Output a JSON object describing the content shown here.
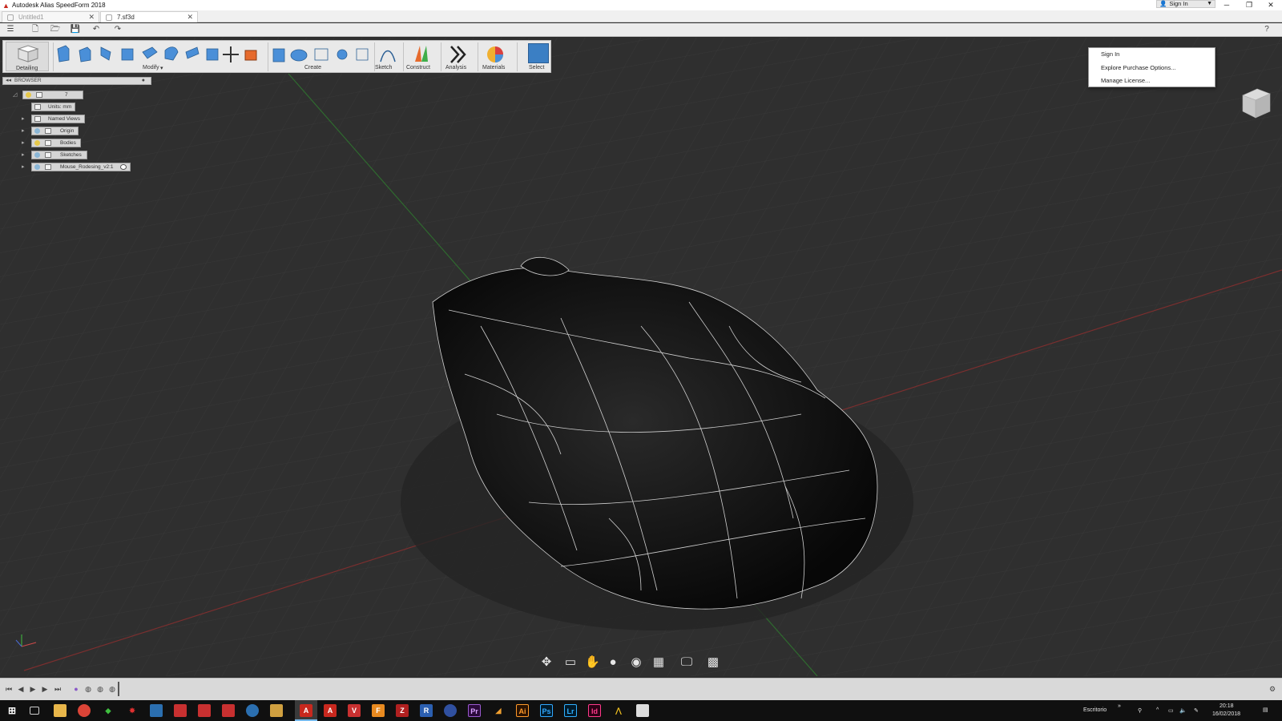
{
  "window": {
    "title": "Autodesk Alias SpeedForm 2018",
    "sign_in_label": "Sign In",
    "minimize": "─",
    "restore": "❐",
    "close": "✕"
  },
  "tabs": [
    {
      "label": "Untitled1",
      "close": "✕"
    },
    {
      "label": "7.sf3d",
      "close": "✕"
    }
  ],
  "signin_menu": [
    "Sign In",
    "Explore Purchase Options...",
    "Manage License..."
  ],
  "ribbon": {
    "workspace": "Detailing",
    "groups": [
      "Modify",
      "Create",
      "Sketch",
      "Construct",
      "Analysis",
      "Materials",
      "Select"
    ]
  },
  "browser": {
    "title": "BROWSER",
    "root_label": "7",
    "items": [
      {
        "label": "Units: mm"
      },
      {
        "label": "Named Views"
      },
      {
        "label": "Origin"
      },
      {
        "label": "Bodies"
      },
      {
        "label": "Sketches"
      },
      {
        "label": "Mouse_Rodesing_v2:1"
      }
    ]
  },
  "taskbar": {
    "desktop_label": "Escritorio",
    "time": "20:18",
    "date": "16/02/2018",
    "apps": [
      "A",
      "A",
      "V",
      "F",
      "Z",
      "R",
      "Pr",
      "Ai",
      "Ps",
      "Lr",
      "Id"
    ]
  },
  "colors": {
    "accent": "#3b7fc4",
    "app_red": "#c8281e",
    "grid_bg": "#2f2f2f",
    "model": "#0d0d0d"
  }
}
